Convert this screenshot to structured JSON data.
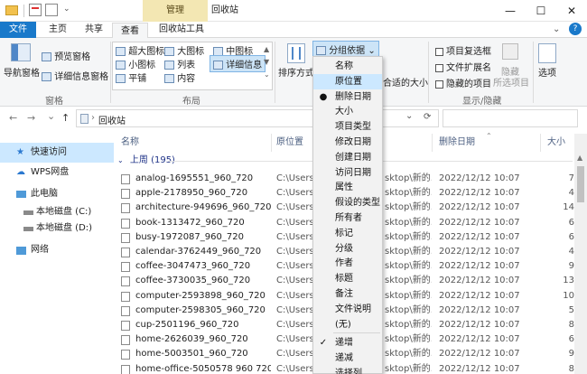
{
  "window": {
    "contextual_tab": "管理",
    "title": "回收站",
    "controls": {
      "minimize": "—",
      "maximize": "☐",
      "close": "✕"
    }
  },
  "tabs": [
    {
      "label": "文件"
    },
    {
      "label": "主页"
    },
    {
      "label": "共享"
    },
    {
      "label": "查看"
    },
    {
      "label": "回收站工具"
    }
  ],
  "ribbon": {
    "nav_pane": "导航窗格",
    "preview_pane": "预览窗格",
    "details_pane": "详细信息窗格",
    "panes_group": "窗格",
    "layout": {
      "xl_icons": "超大图标",
      "large_icons": "大图标",
      "medium_icons": "中图标",
      "small_icons": "小图标",
      "list": "列表",
      "details": "详细信息",
      "tiles": "平铺",
      "content": "内容",
      "group": "布局"
    },
    "sort_by": "排序方式",
    "group_by": "分组依据",
    "size_columns_fit": "合适的大小",
    "show_hide": {
      "item_checkboxes": "项目复选框",
      "file_extensions": "文件扩展名",
      "hidden_items": "隐藏的项目",
      "hide": "隐藏",
      "selected_items": "所选项目",
      "options": "选项",
      "group": "显示/隐藏"
    }
  },
  "address": {
    "back": "←",
    "forward": "→",
    "recent": "⌄",
    "up": "↑",
    "path": "回收站",
    "dropdown": "⌄",
    "refresh": "⟳",
    "search_placeholder": ""
  },
  "nav_pane": {
    "items": [
      {
        "label": "快速访问"
      },
      {
        "label": "WPS网盘"
      },
      {
        "label": "此电脑"
      },
      {
        "label": "本地磁盘 (C:)"
      },
      {
        "label": "本地磁盘 (D:)"
      },
      {
        "label": "网络"
      }
    ]
  },
  "columns": {
    "name": "名称",
    "original_location": "原位置",
    "date_deleted": "删除日期",
    "size": "大小"
  },
  "group_header": "上周 (195)",
  "files": [
    {
      "name": "analog-1695551_960_720",
      "loc": "C:\\Users\\",
      "loc2": "sktop\\新的...",
      "date": "2022/12/12 10:07",
      "size": "7"
    },
    {
      "name": "apple-2178950_960_720",
      "loc": "C:\\Users\\",
      "loc2": "sktop\\新的...",
      "date": "2022/12/12 10:07",
      "size": "4"
    },
    {
      "name": "architecture-949696_960_720",
      "loc": "C:\\Users\\",
      "loc2": "sktop\\新的...",
      "date": "2022/12/12 10:07",
      "size": "14"
    },
    {
      "name": "book-1313472_960_720",
      "loc": "C:\\Users\\",
      "loc2": "sktop\\新的...",
      "date": "2022/12/12 10:07",
      "size": "6"
    },
    {
      "name": "busy-1972087_960_720",
      "loc": "C:\\Users\\",
      "loc2": "sktop\\新的...",
      "date": "2022/12/12 10:07",
      "size": "6"
    },
    {
      "name": "calendar-3762449_960_720",
      "loc": "C:\\Users\\",
      "loc2": "sktop\\新的...",
      "date": "2022/12/12 10:07",
      "size": "4"
    },
    {
      "name": "coffee-3047473_960_720",
      "loc": "C:\\Users\\",
      "loc2": "sktop\\新的...",
      "date": "2022/12/12 10:07",
      "size": "9"
    },
    {
      "name": "coffee-3730035_960_720",
      "loc": "C:\\Users\\",
      "loc2": "sktop\\新的...",
      "date": "2022/12/12 10:07",
      "size": "13"
    },
    {
      "name": "computer-2593898_960_720",
      "loc": "C:\\Users\\",
      "loc2": "sktop\\新的...",
      "date": "2022/12/12 10:07",
      "size": "10"
    },
    {
      "name": "computer-2598305_960_720",
      "loc": "C:\\Users\\",
      "loc2": "sktop\\新的...",
      "date": "2022/12/12 10:07",
      "size": "5"
    },
    {
      "name": "cup-2501196_960_720",
      "loc": "C:\\Users\\",
      "loc2": "sktop\\新的...",
      "date": "2022/12/12 10:07",
      "size": "8"
    },
    {
      "name": "home-2626039_960_720",
      "loc": "C:\\Users\\",
      "loc2": "sktop\\新的...",
      "date": "2022/12/12 10:07",
      "size": "6"
    },
    {
      "name": "home-5003501_960_720",
      "loc": "C:\\Users\\",
      "loc2": "sktop\\新的...",
      "date": "2022/12/12 10:07",
      "size": "9"
    },
    {
      "name": "home-office-5050578 960 720",
      "loc": "C:\\Users\\",
      "loc2": "sktop\\新的...",
      "date": "2022/12/12 10:07",
      "size": "8"
    }
  ],
  "groupby_menu": {
    "items": [
      {
        "label": "名称",
        "mark": ""
      },
      {
        "label": "原位置",
        "mark": ""
      },
      {
        "label": "删除日期",
        "mark": "●"
      },
      {
        "label": "大小",
        "mark": ""
      },
      {
        "label": "项目类型",
        "mark": ""
      },
      {
        "label": "修改日期",
        "mark": ""
      },
      {
        "label": "创建日期",
        "mark": ""
      },
      {
        "label": "访问日期",
        "mark": ""
      },
      {
        "label": "属性",
        "mark": ""
      },
      {
        "label": "假设的类型",
        "mark": ""
      },
      {
        "label": "所有者",
        "mark": ""
      },
      {
        "label": "标记",
        "mark": ""
      },
      {
        "label": "分级",
        "mark": ""
      },
      {
        "label": "作者",
        "mark": ""
      },
      {
        "label": "标题",
        "mark": ""
      },
      {
        "label": "备注",
        "mark": ""
      },
      {
        "label": "文件说明",
        "mark": ""
      },
      {
        "label": "(无)",
        "mark": ""
      },
      {
        "label": "递增",
        "mark": "✓"
      },
      {
        "label": "递减",
        "mark": ""
      },
      {
        "label": "选择列...",
        "mark": ""
      }
    ]
  }
}
